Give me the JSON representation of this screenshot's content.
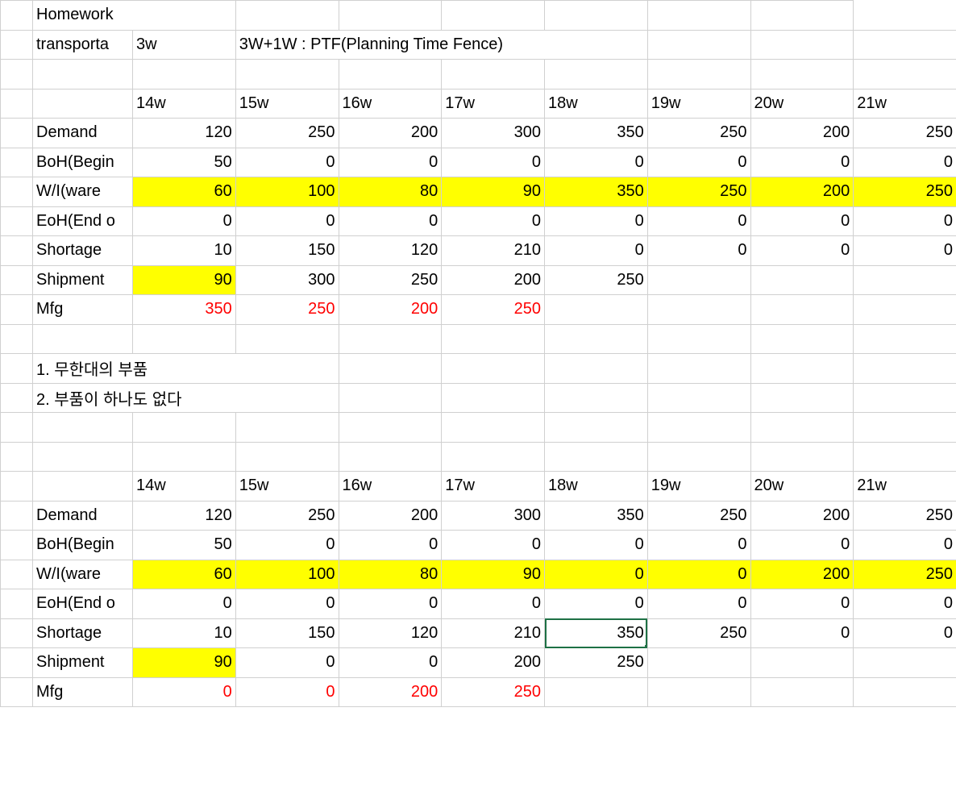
{
  "top": {
    "r0c1": "Homework",
    "r1c1": "transporta",
    "r1c2": "3w",
    "r1c3": "3W+1W : PTF(Planning Time Fence)"
  },
  "weeks": [
    "14w",
    "15w",
    "16w",
    "17w",
    "18w",
    "19w",
    "20w",
    "21w"
  ],
  "labels": {
    "demand": "Demand",
    "boh": "BoH(Begin",
    "wi": "W/I(ware",
    "eoh": "EoH(End o",
    "shortage": "Shortage",
    "shipment": "Shipment",
    "mfg": "Mfg"
  },
  "t1": {
    "demand": [
      "120",
      "250",
      "200",
      "300",
      "350",
      "250",
      "200",
      "250"
    ],
    "boh": [
      "50",
      "0",
      "0",
      "0",
      "0",
      "0",
      "0",
      "0"
    ],
    "wi": [
      "60",
      "100",
      "80",
      "90",
      "350",
      "250",
      "200",
      "250"
    ],
    "eoh": [
      "0",
      "0",
      "0",
      "0",
      "0",
      "0",
      "0",
      "0"
    ],
    "shortage": [
      "10",
      "150",
      "120",
      "210",
      "0",
      "0",
      "0",
      "0"
    ],
    "shipment": [
      "90",
      "300",
      "250",
      "200",
      "250",
      "",
      "",
      ""
    ],
    "mfg": [
      "350",
      "250",
      "200",
      "250",
      "",
      "",
      "",
      ""
    ]
  },
  "notes": {
    "n1": "1. 무한대의 부품",
    "n2": "2. 부품이 하나도 없다"
  },
  "t2": {
    "demand": [
      "120",
      "250",
      "200",
      "300",
      "350",
      "250",
      "200",
      "250"
    ],
    "boh": [
      "50",
      "0",
      "0",
      "0",
      "0",
      "0",
      "0",
      "0"
    ],
    "wi": [
      "60",
      "100",
      "80",
      "90",
      "0",
      "0",
      "200",
      "250"
    ],
    "eoh": [
      "0",
      "0",
      "0",
      "0",
      "0",
      "0",
      "0",
      "0"
    ],
    "shortage": [
      "10",
      "150",
      "120",
      "210",
      "350",
      "250",
      "0",
      "0"
    ],
    "shipment": [
      "90",
      "0",
      "0",
      "200",
      "250",
      "",
      "",
      ""
    ],
    "mfg": [
      "0",
      "0",
      "200",
      "250",
      "",
      "",
      "",
      ""
    ]
  }
}
